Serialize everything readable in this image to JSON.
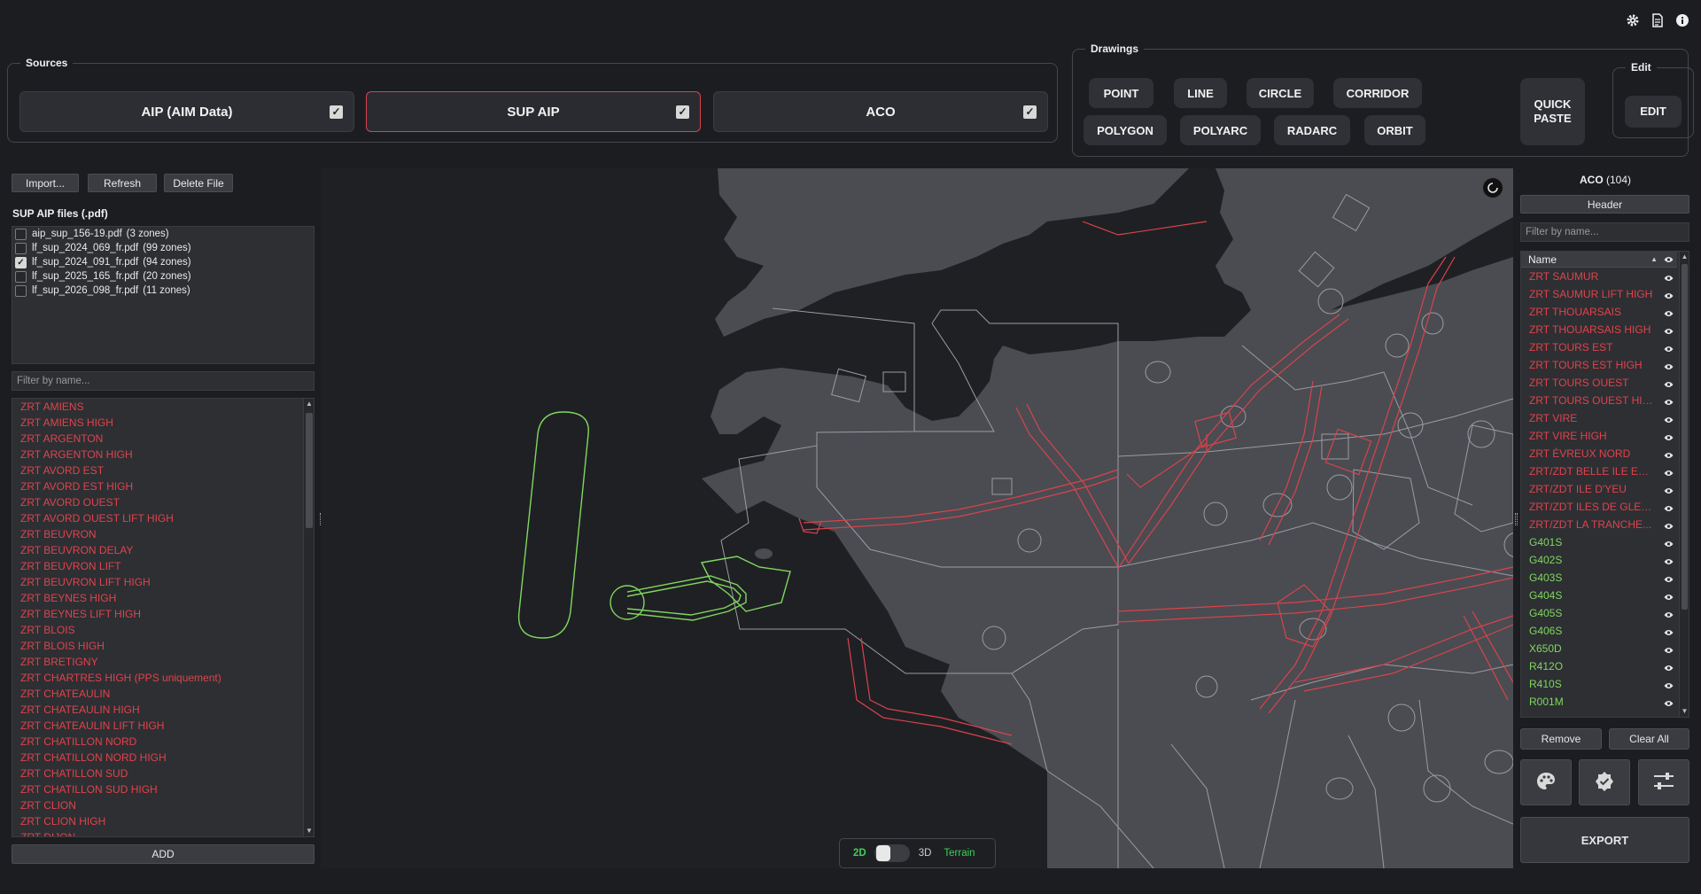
{
  "colors": {
    "accent_red": "#e0434b",
    "accent_green": "#7fd85f",
    "toggle_green": "#3fcf55"
  },
  "top_icons": [
    "gear-icon",
    "document-icon",
    "info-icon"
  ],
  "sources": {
    "title": "Sources",
    "buttons": [
      {
        "label": "AIP (AIM Data)",
        "checked": true,
        "active": false
      },
      {
        "label": "SUP AIP",
        "checked": true,
        "active": true
      },
      {
        "label": "ACO",
        "checked": true,
        "active": false
      }
    ]
  },
  "drawings": {
    "title": "Drawings",
    "buttons": [
      "POINT",
      "LINE",
      "CIRCLE",
      "CORRIDOR",
      "POLYGON",
      "POLYARC",
      "RADARC",
      "ORBIT"
    ],
    "quick_paste_line1": "QUICK",
    "quick_paste_line2": "PASTE"
  },
  "edit": {
    "title": "Edit",
    "button": "EDIT"
  },
  "left": {
    "import_label": "Import...",
    "refresh_label": "Refresh",
    "delete_label": "Delete File",
    "files_title": "SUP AIP files (.pdf)",
    "files": [
      {
        "name": "aip_sup_156-19.pdf",
        "zones": "(3 zones)",
        "checked": false
      },
      {
        "name": "lf_sup_2024_069_fr.pdf",
        "zones": "(99 zones)",
        "checked": false
      },
      {
        "name": "lf_sup_2024_091_fr.pdf",
        "zones": "(94 zones)",
        "checked": true
      },
      {
        "name": "lf_sup_2025_165_fr.pdf",
        "zones": "(20 zones)",
        "checked": false
      },
      {
        "name": "lf_sup_2026_098_fr.pdf",
        "zones": "(11 zones)",
        "checked": false
      }
    ],
    "filter_placeholder": "Filter by name...",
    "zones": [
      "ZRT AMIENS",
      "ZRT AMIENS HIGH",
      "ZRT ARGENTON",
      "ZRT ARGENTON HIGH",
      "ZRT AVORD EST",
      "ZRT AVORD EST HIGH",
      "ZRT AVORD OUEST",
      "ZRT AVORD OUEST LIFT HIGH",
      "ZRT BEUVRON",
      "ZRT BEUVRON DELAY",
      "ZRT BEUVRON LIFT",
      "ZRT BEUVRON LIFT HIGH",
      "ZRT BEYNES HIGH",
      "ZRT BEYNES LIFT HIGH",
      "ZRT BLOIS",
      "ZRT BLOIS HIGH",
      "ZRT BRETIGNY",
      "ZRT CHARTRES HIGH (PPS uniquement)",
      "ZRT CHATEAULIN",
      "ZRT CHATEAULIN HIGH",
      "ZRT CHATEAULIN LIFT HIGH",
      "ZRT CHATILLON NORD",
      "ZRT CHATILLON NORD HIGH",
      "ZRT CHATILLON SUD",
      "ZRT CHATILLON SUD HIGH",
      "ZRT CLION",
      "ZRT CLION HIGH",
      "ZRT DIJON"
    ],
    "add_label": "ADD"
  },
  "map": {
    "toggle_2d": "2D",
    "toggle_3d": "3D",
    "terrain_label": "Terrain",
    "mode": "2D"
  },
  "right": {
    "title_name": "ACO",
    "title_count": "(104)",
    "header_label": "Header",
    "filter_placeholder": "Filter by name...",
    "column_name": "Name",
    "rows": [
      {
        "name": "ZRT SAUMUR",
        "color": "red"
      },
      {
        "name": "ZRT SAUMUR LIFT HIGH",
        "color": "red"
      },
      {
        "name": "ZRT THOUARSAIS",
        "color": "red"
      },
      {
        "name": "ZRT THOUARSAIS HIGH",
        "color": "red"
      },
      {
        "name": "ZRT TOURS EST",
        "color": "red"
      },
      {
        "name": "ZRT TOURS EST HIGH",
        "color": "red"
      },
      {
        "name": "ZRT TOURS OUEST",
        "color": "red"
      },
      {
        "name": "ZRT TOURS OUEST HIGH",
        "color": "red"
      },
      {
        "name": "ZRT VIRE",
        "color": "red"
      },
      {
        "name": "ZRT VIRE HIGH",
        "color": "red"
      },
      {
        "name": "ZRT ÉVREUX NORD",
        "color": "red"
      },
      {
        "name": "ZRT/ZDT BELLE ILE EN ...",
        "color": "red"
      },
      {
        "name": "ZRT/ZDT ILE D'YEU",
        "color": "red"
      },
      {
        "name": "ZRT/ZDT ILES DE GLEN...",
        "color": "red"
      },
      {
        "name": "ZRT/ZDT LA TRANCHE...",
        "color": "red"
      },
      {
        "name": "G401S",
        "color": "green"
      },
      {
        "name": "G402S",
        "color": "green"
      },
      {
        "name": "G403S",
        "color": "green"
      },
      {
        "name": "G404S",
        "color": "green"
      },
      {
        "name": "G405S",
        "color": "green"
      },
      {
        "name": "G406S",
        "color": "green"
      },
      {
        "name": "X650D",
        "color": "green"
      },
      {
        "name": "R412O",
        "color": "green"
      },
      {
        "name": "R410S",
        "color": "green"
      },
      {
        "name": "R001M",
        "color": "green"
      }
    ],
    "remove_label": "Remove",
    "clear_all_label": "Clear All",
    "icon_buttons": [
      "palette-icon",
      "check-badge-icon",
      "sliders-icon"
    ],
    "export_label": "EXPORT"
  }
}
